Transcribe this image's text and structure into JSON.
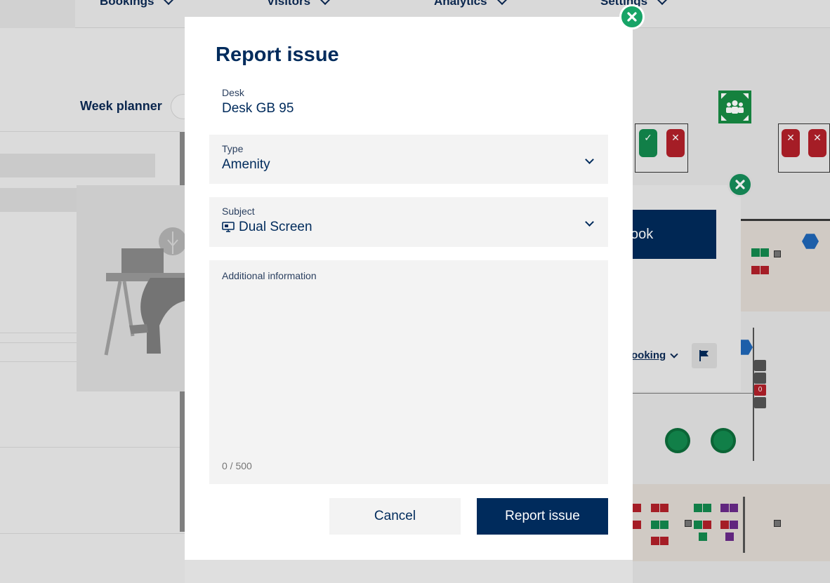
{
  "nav": {
    "items": [
      "Bookings",
      "Visitors",
      "Analytics",
      "Settings"
    ]
  },
  "left_panel": {
    "week_planner": "Week planner"
  },
  "back_dialog": {
    "book_label": "ook",
    "booking_link": "ooking"
  },
  "floorplan": {
    "counter_badge": "0"
  },
  "modal": {
    "title": "Report issue",
    "desk": {
      "label": "Desk",
      "value": "Desk GB 95"
    },
    "type": {
      "label": "Type",
      "value": "Amenity"
    },
    "subject": {
      "label": "Subject",
      "value": "Dual Screen",
      "icon": "monitor-icon"
    },
    "additional": {
      "label": "Additional information",
      "counter": "0 / 500"
    },
    "cancel_label": "Cancel",
    "report_label": "Report issue"
  },
  "colors": {
    "primary": "#002b5c",
    "accent_green": "#17a467",
    "field_bg": "#f3f3f3",
    "status_red": "#b3202a",
    "status_green": "#138a4f"
  }
}
